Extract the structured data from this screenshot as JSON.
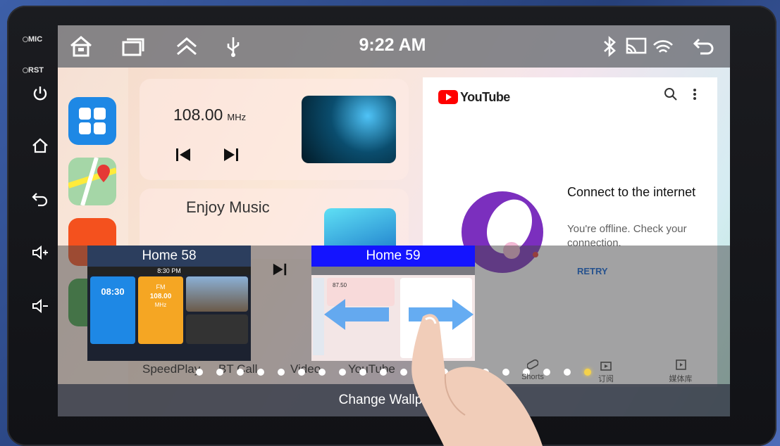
{
  "device": {
    "mic_label": "MIC",
    "rst_label": "RST",
    "side_buttons": [
      "power-icon",
      "home-icon",
      "back-icon",
      "volume-up-icon",
      "volume-down-icon"
    ]
  },
  "status_bar": {
    "time": "9:22 AM",
    "left_icons": [
      "home-icon",
      "recent-apps-icon",
      "chevron-up-icon",
      "usb-icon"
    ],
    "right_icons": [
      "bluetooth-icon",
      "cast-icon",
      "wireless-icon",
      "back-icon"
    ]
  },
  "radio": {
    "frequency": "108.00",
    "unit": "MHz"
  },
  "music": {
    "title": "Enjoy Music"
  },
  "youtube": {
    "brand": "YouTube",
    "title": "Connect to the internet",
    "subtitle": "You're offline. Check your connection.",
    "retry_label": "RETRY",
    "nav": [
      {
        "label": "Shorts"
      },
      {
        "label": "订阅"
      },
      {
        "label": "媒体库"
      }
    ]
  },
  "wallpaper_picker": {
    "items": [
      {
        "label": "Home 58",
        "time": "8:30 PM",
        "clock": "08:30",
        "fm": "FM",
        "fm_freq": "108.00",
        "fm_unit": "MHz",
        "selected": false
      },
      {
        "label": "Home 59",
        "freq": "87.50",
        "selected": true
      }
    ],
    "page_dots_total": 20,
    "page_dots_active": 20
  },
  "app_labels": [
    "SpeedPlay",
    "BT Call",
    "Video",
    "YouTube"
  ],
  "bottom_button": "Change Wallpaper",
  "colors": {
    "status_bar": "#6e7076",
    "selected_header": "#1414ff",
    "unselected_header": "#2c3e5e",
    "youtube_red": "#ff0000",
    "retry_blue": "#065fd4",
    "active_dot": "#f5d24a"
  }
}
